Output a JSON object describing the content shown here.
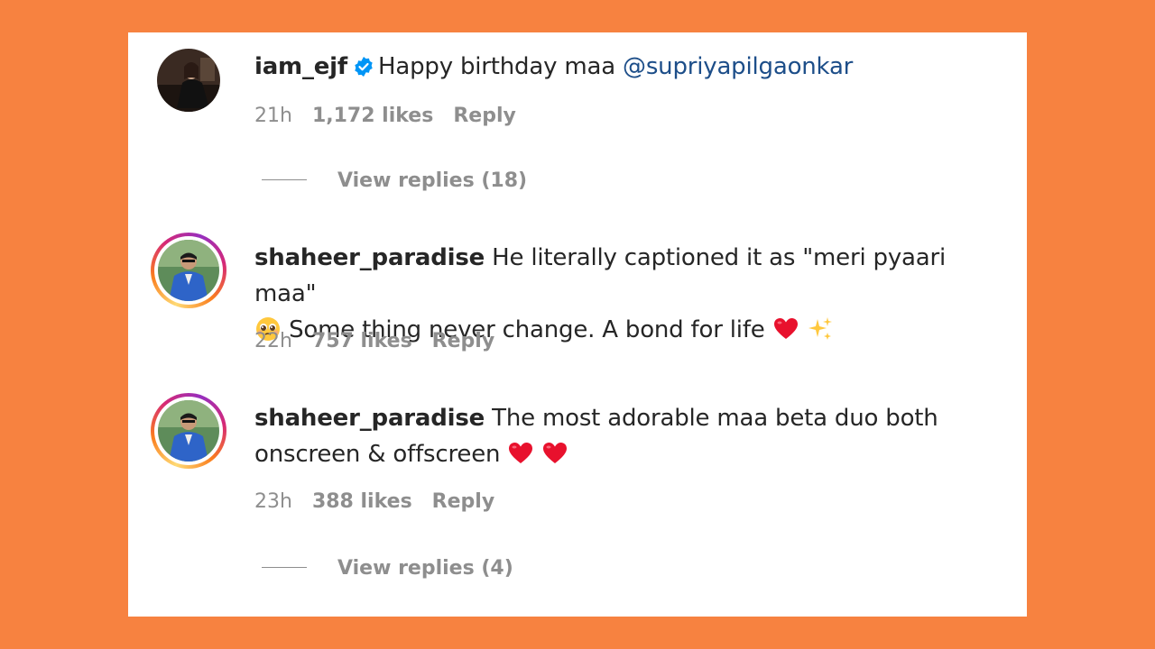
{
  "comments": [
    {
      "username": "iam_ejf",
      "verified": true,
      "text": "Happy birthday maa",
      "mention": "@supriyapilgaonkar",
      "time": "21h",
      "likes": "1,172 likes",
      "reply": "Reply",
      "view_replies": "View replies (18)"
    },
    {
      "username": "shaheer_paradise",
      "text_line1": "He literally captioned it as \"meri pyaari maa\"",
      "text_line2": "Some thing never change. A bond for life",
      "emojis": [
        "pleading-face-emoji",
        "red-heart-emoji",
        "sparkles-emoji"
      ],
      "time": "22h",
      "likes": "757 likes",
      "reply": "Reply"
    },
    {
      "username": "shaheer_paradise",
      "text_line1": "The most adorable maa beta duo both",
      "text_line2": "onscreen & offscreen",
      "emojis": [
        "red-heart-emoji",
        "red-heart-emoji"
      ],
      "time": "23h",
      "likes": "388 likes",
      "reply": "Reply",
      "view_replies": "View replies (4)"
    }
  ],
  "colors": {
    "background": "#F78240",
    "card": "#FFFFFF",
    "text": "#262626",
    "muted": "#8E8E8E",
    "mention": "#1D4E89",
    "verified": "#0095F6"
  }
}
